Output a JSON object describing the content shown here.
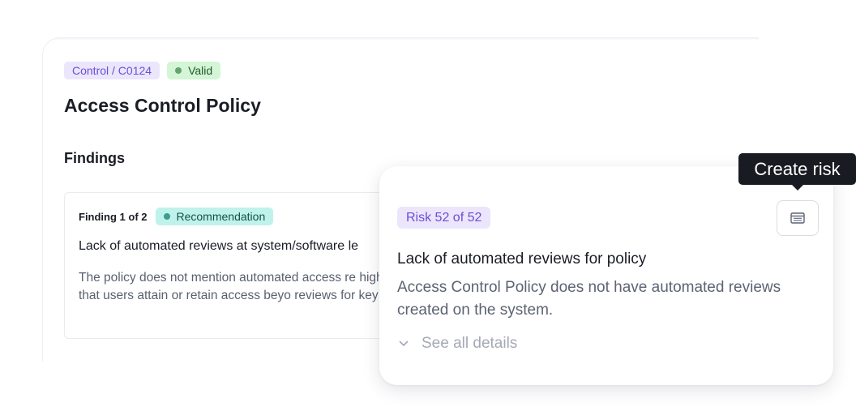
{
  "control": {
    "breadcrumb": "Control / C0124",
    "status": "Valid",
    "title": "Access Control Policy",
    "section": "Findings"
  },
  "finding": {
    "count": "Finding 1 of 2",
    "type": "Recommendation",
    "title": "Lack of automated reviews at system/software le",
    "body": "The policy does not mention automated access re higher risk that users attain or retain access beyo reviews for key systems."
  },
  "risk": {
    "badge": "Risk 52 of 52",
    "title": "Lack of automated reviews for policy",
    "description": "Access Control Policy does not have automated reviews created on the system.",
    "details_label": "See all details",
    "details_icon": "chevron-down-icon",
    "button_icon": "table-icon"
  },
  "tooltip": {
    "text": "Create risk"
  },
  "colors": {
    "accent_purple": "#6a4fd6",
    "accent_purple_bg": "#ebe6fb",
    "valid_bg": "#d4f5d6",
    "recommendation_bg": "#bff2ea",
    "tooltip_bg": "#181b22"
  }
}
